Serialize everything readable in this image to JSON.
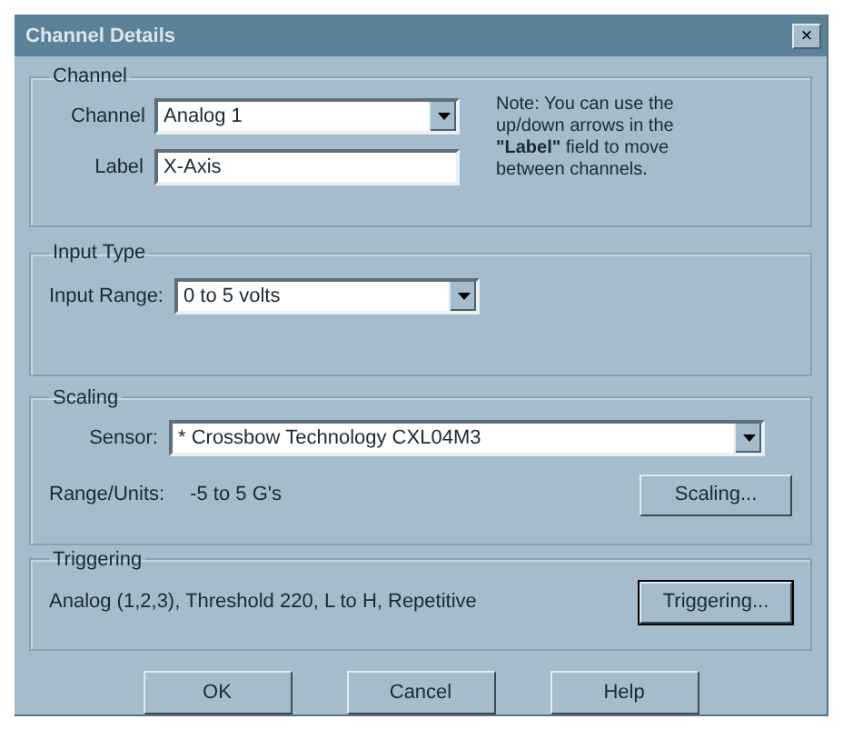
{
  "window": {
    "title": "Channel Details",
    "close": "×"
  },
  "channel_group": {
    "title": "Channel",
    "channel_label": "Channel",
    "channel_value": "Analog 1",
    "label_label": "Label",
    "label_value": "X-Axis",
    "note": "Note: You can use the up/down arrows in the **\"Label\"** field to move between channels."
  },
  "input_type": {
    "title": "Input Type",
    "range_label": "Input Range:",
    "range_value": "0 to 5 volts"
  },
  "scaling": {
    "title": "Scaling",
    "sensor_label": "Sensor:",
    "sensor_value": "* Crossbow Technology CXL04M3",
    "range_units_label": "Range/Units:",
    "range_units_value": "-5 to 5 G's",
    "button": "Scaling..."
  },
  "triggering": {
    "title": "Triggering",
    "summary": "Analog (1,2,3), Threshold 220, L to H, Repetitive",
    "button": "Triggering..."
  },
  "buttons": [
    "OK",
    "Cancel",
    "Help"
  ]
}
